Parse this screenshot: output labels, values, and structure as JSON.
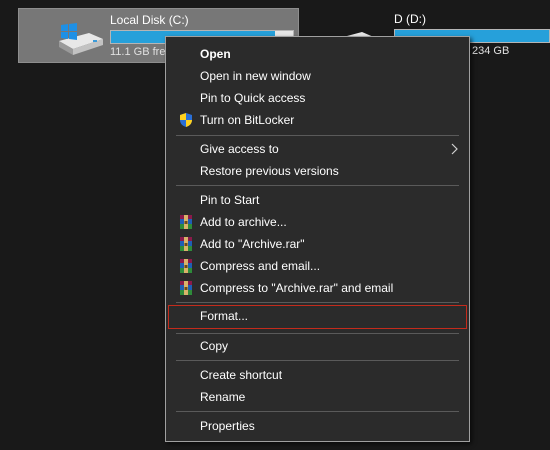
{
  "drives": {
    "c": {
      "name": "Local Disk (C:)",
      "free_text": "11.1 GB fre",
      "usage_fraction": 0.9,
      "icon": "windows-drive-icon"
    },
    "d": {
      "name": "D (D:)",
      "free_text": "234 GB",
      "usage_fraction": 1.0,
      "icon": "drive-icon"
    }
  },
  "context_menu": {
    "open": "Open",
    "open_new_window": "Open in new window",
    "pin_quick_access": "Pin to Quick access",
    "turn_on_bitlocker": "Turn on BitLocker",
    "give_access_to": "Give access to",
    "restore_previous_versions": "Restore previous versions",
    "pin_to_start": "Pin to Start",
    "add_to_archive": "Add to archive...",
    "add_to_archive_rar": "Add to \"Archive.rar\"",
    "compress_and_email": "Compress and email...",
    "compress_to_rar_email": "Compress to \"Archive.rar\" and email",
    "format": "Format...",
    "copy": "Copy",
    "create_shortcut": "Create shortcut",
    "rename": "Rename",
    "properties": "Properties"
  },
  "colors": {
    "background": "#191919",
    "menu_background": "#2b2b2b",
    "selected_tile": "#777777",
    "usage_bar": "#26a0da",
    "highlight_border": "#c42b1c"
  }
}
